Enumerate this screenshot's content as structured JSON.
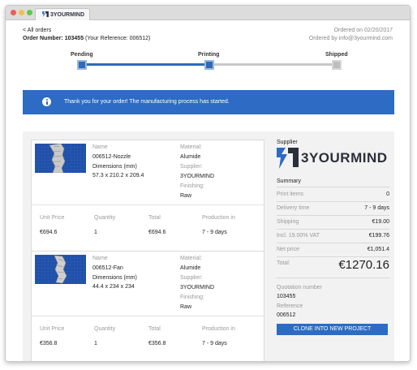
{
  "browser": {
    "tab_title": "3YOURMIND"
  },
  "header": {
    "back_label": "< All orders",
    "order_prefix": "Order Number: 103455",
    "order_reference": " (Your Reference: 006512)",
    "ordered_on": "Ordered on 02/20/2017",
    "ordered_by": "Ordered by info@3yourmind.com"
  },
  "progress": {
    "steps": [
      {
        "label": "Pending",
        "state": "done"
      },
      {
        "label": "Printing",
        "state": "done"
      },
      {
        "label": "Shipped",
        "state": "todo"
      }
    ]
  },
  "banner": {
    "icon": "info-icon",
    "message": "Thank you for your order! The manufacturing process has started."
  },
  "field_labels": {
    "name": "Name",
    "dimensions": "Dimensions (mm)",
    "material": "Material:",
    "supplier": "Supplier:",
    "finishing": "Finishing:",
    "unit_price": "Unit Price",
    "quantity": "Quantity",
    "total": "Total",
    "production": "Production in"
  },
  "items": [
    {
      "name": "006512-Nozzle",
      "dimensions": "57.3 x 210.2 x 209.4",
      "material": "Alumide",
      "supplier": "3YOURMIND",
      "finishing": "Raw",
      "unit_price": "€694.6",
      "quantity": "1",
      "total": "€694.6",
      "production": "7 - 9 days"
    },
    {
      "name": "006512-Fan",
      "dimensions": "44.4 x 234 x 234",
      "material": "Alumide",
      "supplier": "3YOURMIND",
      "finishing": "Raw",
      "unit_price": "€356.8",
      "quantity": "1",
      "total": "€356.8",
      "production": "7 - 9 days"
    }
  ],
  "sidebar": {
    "supplier_heading": "Supplier",
    "supplier_brand": "3YOURMIND",
    "summary_heading": "Summary",
    "rows": [
      {
        "label": "Print items",
        "value": "0"
      },
      {
        "label": "Delivery time",
        "value": "7 - 9 days"
      },
      {
        "label": "Shipping",
        "value": "€19.00"
      },
      {
        "label": "Incl. 19.00% VAT",
        "value": "€199.76"
      },
      {
        "label": "Net price",
        "value": "€1,051.4"
      }
    ],
    "total_label": "Total:",
    "total_value": "€1270.16",
    "quotation_label": "Quotation number",
    "quotation_value": "103455",
    "reference_label": "Reference",
    "reference_value": "006512",
    "clone_button": "CLONE INTO NEW PROJECT"
  },
  "colors": {
    "accent": "#2d6bc4",
    "progress_done": "#2f6ab8",
    "progress_todo": "#c8c8c8"
  }
}
